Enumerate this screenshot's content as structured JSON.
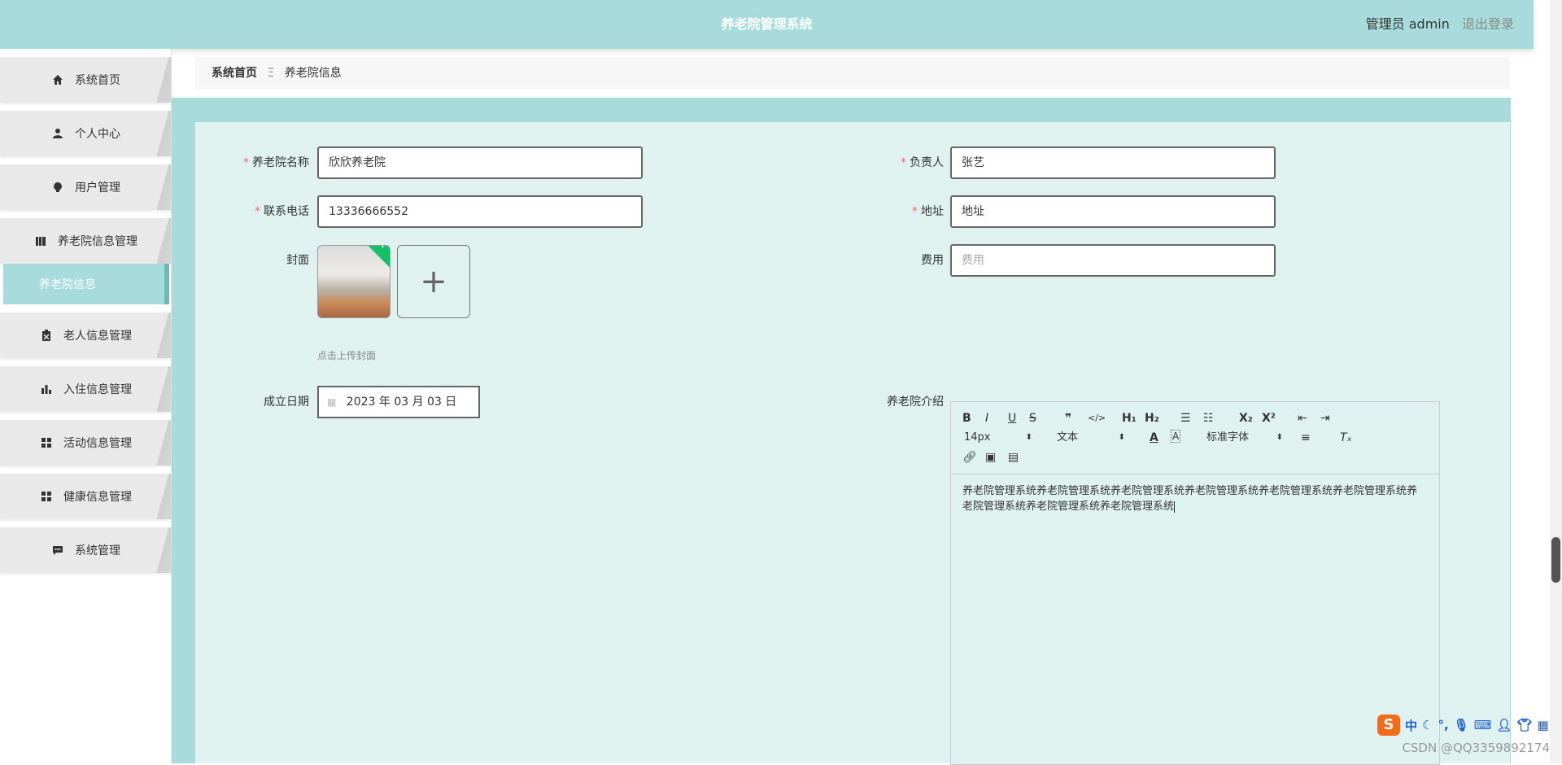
{
  "header": {
    "title": "养老院管理系统",
    "user": "管理员 admin",
    "logout": "退出登录"
  },
  "sidebar": {
    "items": [
      {
        "label": "系统首页",
        "icon": "home-icon"
      },
      {
        "label": "个人中心",
        "icon": "user-icon"
      },
      {
        "label": "用户管理",
        "icon": "bulb-icon"
      },
      {
        "label": "养老院信息管理",
        "icon": "book-icon"
      },
      {
        "label": "老人信息管理",
        "icon": "clipboard-icon"
      },
      {
        "label": "入住信息管理",
        "icon": "bar-chart-icon"
      },
      {
        "label": "活动信息管理",
        "icon": "grid-icon"
      },
      {
        "label": "健康信息管理",
        "icon": "grid-icon"
      },
      {
        "label": "系统管理",
        "icon": "message-icon"
      }
    ],
    "submenu": {
      "label": "养老院信息"
    }
  },
  "breadcrumb": {
    "home": "系统首页",
    "separator": "Ξ",
    "current": "养老院信息"
  },
  "form": {
    "name": {
      "label": "养老院名称",
      "value": "欣欣养老院"
    },
    "manager": {
      "label": "负责人",
      "value": "张艺"
    },
    "phone": {
      "label": "联系电话",
      "value": "13336666552"
    },
    "address": {
      "label": "地址",
      "value": "地址"
    },
    "cover": {
      "label": "封面",
      "hint": "点击上传封面"
    },
    "fee": {
      "label": "费用",
      "placeholder": "费用"
    },
    "founded": {
      "label": "成立日期",
      "value": "2023 年 03 月 03 日"
    },
    "intro": {
      "label": "养老院介绍",
      "content": "养老院管理系统养老院管理系统养老院管理系统养老院管理系统养老院管理系统养老院管理系统养老院管理系统养老院管理系统养老院管理系统"
    }
  },
  "editor": {
    "font_size": "14px",
    "block_type": "文本",
    "font_family": "标准字体"
  },
  "watermark": "CSDN @QQ3359892174",
  "ime": {
    "lang": "中"
  },
  "colors": {
    "accent": "#a8dcdc",
    "panel": "#dff2f0",
    "required": "#f56c6c"
  }
}
